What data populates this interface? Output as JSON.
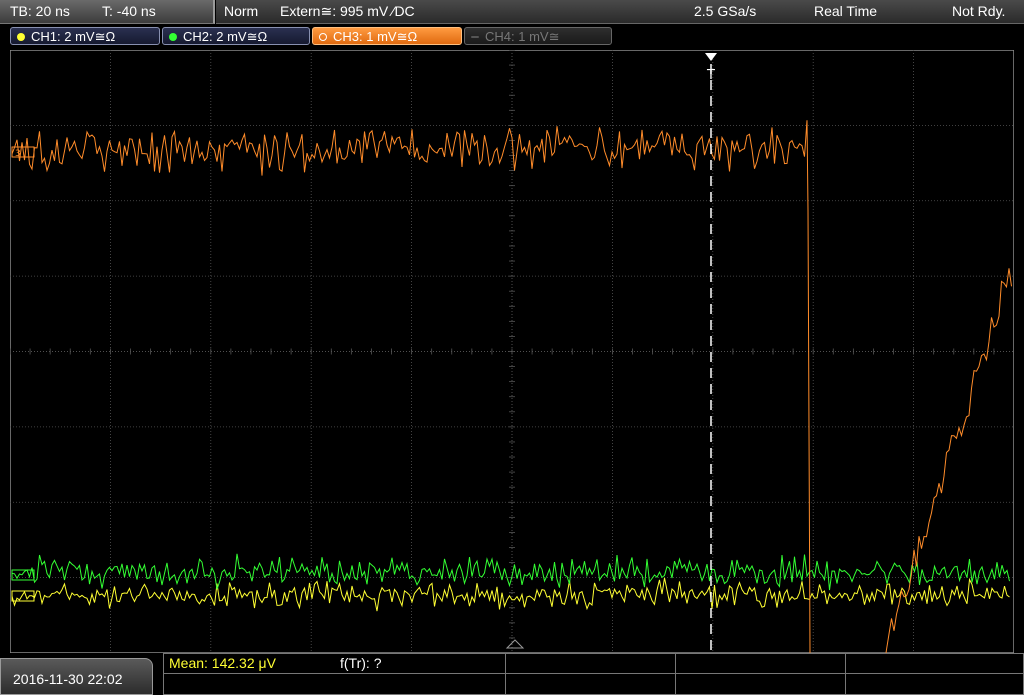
{
  "timebase": {
    "tb": "TB: 20 ns",
    "t": "T: -40 ns"
  },
  "status": {
    "mode": "Norm",
    "trigger": "Extern≅: 995 mV ⁄DC",
    "sample_rate": "2.5 GSa/s",
    "acquisition": "Real Time",
    "state": "Not Rdy."
  },
  "channels": [
    {
      "label": "CH1: 2 mV≅Ω",
      "color": "#ffff33",
      "active": true
    },
    {
      "label": "CH2: 2 mV≅Ω",
      "color": "#33ff33",
      "active": true
    },
    {
      "label": "CH3: 1 mV≅Ω",
      "color": "#ff8c2a",
      "active": true,
      "selected": true
    },
    {
      "label": "CH4: 1 mV≅",
      "color": "#777777",
      "active": false
    }
  ],
  "trigger_marker": {
    "label": "T"
  },
  "measurements": {
    "mean": "Mean: 142.32 μV",
    "frequency": "f(Tr): ?"
  },
  "datetime": "2016-11-30 22:02",
  "colors": {
    "ch1": "#ffff33",
    "ch2": "#33ff33",
    "ch3": "#ff8c2a",
    "grid": "#555555"
  }
}
